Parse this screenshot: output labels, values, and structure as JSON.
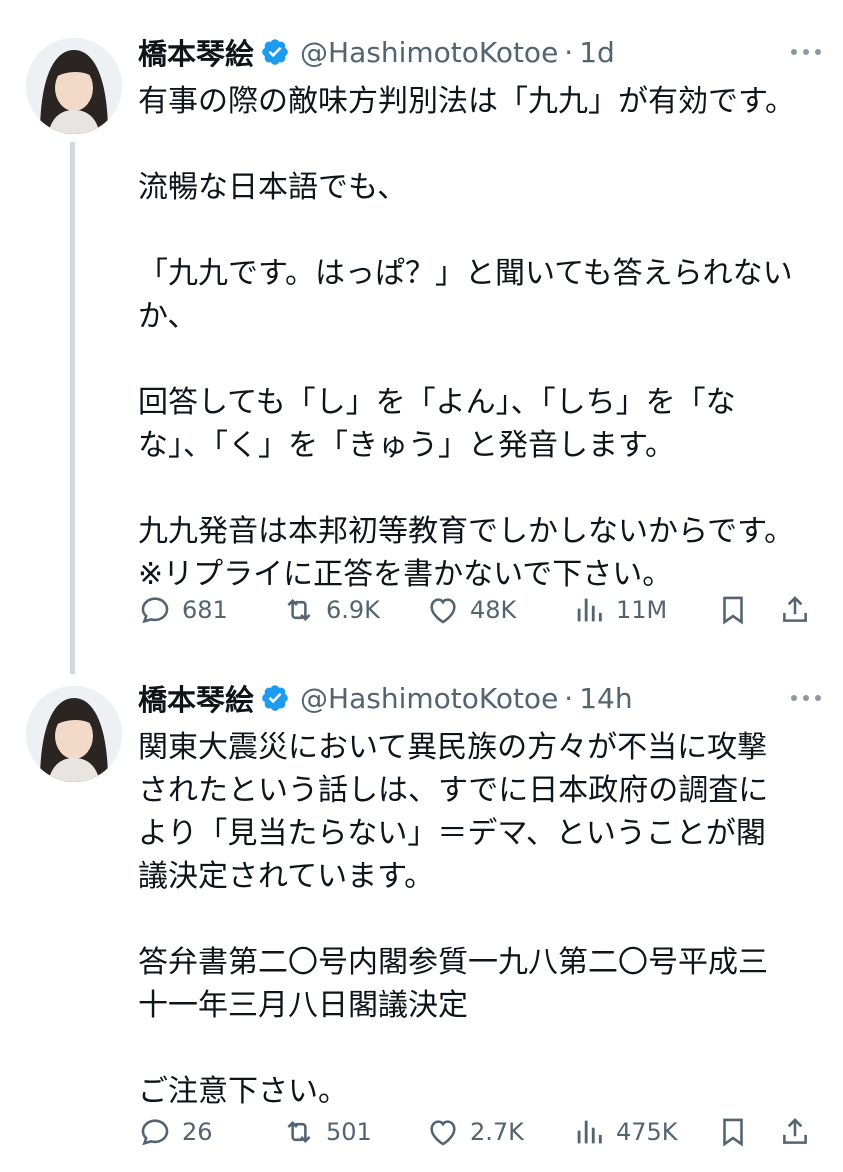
{
  "tweets": [
    {
      "author_name": "橋本琴絵",
      "handle": "@HashimotoKotoe",
      "time": "1d",
      "lines": [
        "有事の際の敵味方判別法は「九九」が有効です。",
        "",
        "流暢な日本語でも、",
        "",
        "「九九です。はっぱ？」と聞いても答えられない",
        "か、",
        "",
        "回答しても「し」を「よん」、「しち」を「な",
        "な」、「く」を「きゅう」と発音します。",
        "",
        "九九発音は本邦初等教育でしかしないからです。",
        "※リプライに正答を書かないで下さい。"
      ],
      "stats": {
        "replies": "681",
        "reposts": "6.9K",
        "likes": "48K",
        "views": "11M"
      }
    },
    {
      "author_name": "橋本琴絵",
      "handle": "@HashimotoKotoe",
      "time": "14h",
      "lines": [
        "関東大震災において異民族の方々が不当に攻撃",
        "されたという話しは、すでに日本政府の調査に",
        "より「見当たらない」＝デマ、ということが閣",
        "議決定されています。",
        "",
        "答弁書第二〇号内閣参質一九八第二〇号平成三",
        "十一年三月八日閣議決定",
        "",
        "ご注意下さい。"
      ],
      "stats": {
        "replies": "26",
        "reposts": "501",
        "likes": "2.7K",
        "views": "475K"
      }
    }
  ],
  "colors": {
    "text": "#0f1419",
    "secondary": "#536471",
    "verified": "#1d9bf0",
    "thread_line": "#cfd9de"
  }
}
